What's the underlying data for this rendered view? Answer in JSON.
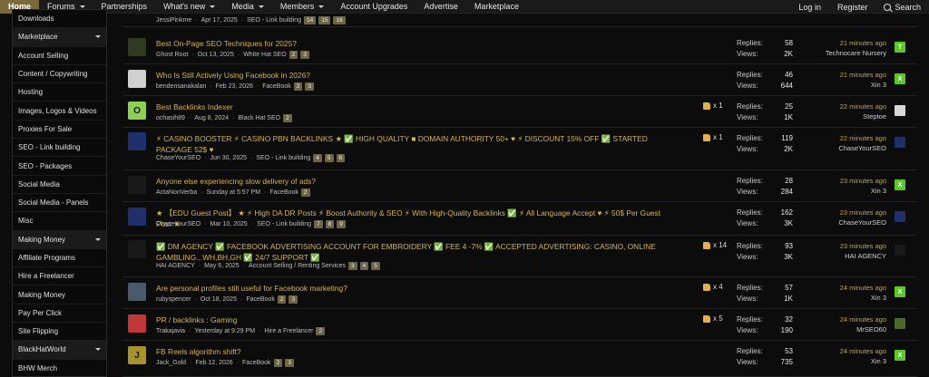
{
  "nav": {
    "items": [
      {
        "label": "Home",
        "caret": false
      },
      {
        "label": "Forums",
        "caret": true
      },
      {
        "label": "Partnerships",
        "caret": false
      },
      {
        "label": "What's new",
        "caret": true
      },
      {
        "label": "Media",
        "caret": true
      },
      {
        "label": "Members",
        "caret": true
      },
      {
        "label": "Account Upgrades",
        "caret": false
      },
      {
        "label": "Advertise",
        "caret": false
      },
      {
        "label": "Marketplace",
        "caret": false
      }
    ],
    "login": "Log in",
    "register": "Register",
    "search": "Search"
  },
  "sidebar": {
    "items": [
      {
        "label": "Downloads",
        "header": false
      },
      {
        "label": "Marketplace",
        "header": true
      },
      {
        "label": "Account Selling",
        "header": false
      },
      {
        "label": "Content / Copywriting",
        "header": false
      },
      {
        "label": "Hosting",
        "header": false
      },
      {
        "label": "Images, Logos & Videos",
        "header": false
      },
      {
        "label": "Proxies For Sale",
        "header": false
      },
      {
        "label": "SEO - Link building",
        "header": false
      },
      {
        "label": "SEO - Packages",
        "header": false
      },
      {
        "label": "Social Media",
        "header": false
      },
      {
        "label": "Social Media - Panels",
        "header": false
      },
      {
        "label": "Misc",
        "header": false
      },
      {
        "label": "Making Money",
        "header": true
      },
      {
        "label": "Affiliate Programs",
        "header": false
      },
      {
        "label": "Hire a Freelancer",
        "header": false
      },
      {
        "label": "Making Money",
        "header": false
      },
      {
        "label": "Pay Per Click",
        "header": false
      },
      {
        "label": "Site Flipping",
        "header": false
      },
      {
        "label": "BlackHatWorld",
        "header": true
      },
      {
        "label": "BHW Merch",
        "header": false
      }
    ]
  },
  "threads": {
    "top_partial": {
      "author": "JessiPinkme",
      "date": "Apr 17, 2025",
      "forum": "SEO - Link building",
      "pages": [
        "14",
        "15",
        "16"
      ]
    },
    "rows": [
      {
        "title": "Best On-Page SEO Techniques for 2025?",
        "author": "Ghost Root",
        "date": "Oct 13, 2025",
        "forum": "White Hat SEO",
        "pages": [
          "2",
          "3"
        ],
        "likes": "",
        "replies": "58",
        "views": "2K",
        "last_time": "21 minutes ago",
        "last_user": "Technocare Nursery",
        "avatar_letter": "",
        "mini_letter": "T"
      },
      {
        "title": "Who Is Still Actively Using Facebook in 2026?",
        "author": "bendensanakalan",
        "date": "Feb 23, 2026",
        "forum": "FaceBook",
        "pages": [
          "2",
          "3"
        ],
        "likes": "",
        "replies": "46",
        "views": "644",
        "last_time": "21 minutes ago",
        "last_user": "Xin 3",
        "avatar_letter": "",
        "mini_letter": "X"
      },
      {
        "title": "Best Backlinks Indexer",
        "author": "ochasih89",
        "date": "Aug 8, 2024",
        "forum": "Black Hat SEO",
        "pages": [
          "2"
        ],
        "likes": "x 1",
        "replies": "25",
        "views": "1K",
        "last_time": "22 minutes ago",
        "last_user": "Steptoe",
        "avatar_letter": "O",
        "mini_letter": ""
      },
      {
        "title": "⚡ CASINO BOOSTER ⚡ CASINO PBN BACKLINKS ★ ✅ HIGH QUALITY ■ DOMAIN AUTHORITY 50+ ♥ ⚡ DISCOUNT 15% OFF ✅ STARTED PACKAGE 52$ ♥",
        "author": "ChaseYourSEO",
        "date": "Jun 30, 2025",
        "forum": "SEO - Link building",
        "pages": [
          "4",
          "5",
          "6"
        ],
        "likes": "x 1",
        "replies": "119",
        "views": "2K",
        "last_time": "22 minutes ago",
        "last_user": "ChaseYourSEO",
        "avatar_letter": "",
        "mini_letter": ""
      },
      {
        "title": "Anyone else experiencing slow delivery of ads?",
        "author": "ActaNonVerba",
        "date": "Sunday at 5:57 PM",
        "forum": "FaceBook",
        "pages": [
          "2"
        ],
        "likes": "",
        "replies": "28",
        "views": "284",
        "last_time": "23 minutes ago",
        "last_user": "Xin 3",
        "avatar_letter": "",
        "mini_letter": "X"
      },
      {
        "title": "★ 【EDU Guest Post】 ★ ⚡ High DA DR Posts ⚡ Boost Authority & SEO ⚡ With High-Quality Backlinks ✅ ⚡ All Language Accept ♥ ⚡ 50$ Per Guest Post ★",
        "author": "ChaseYourSEO",
        "date": "Mar 10, 2025",
        "forum": "SEO - Link building",
        "pages": [
          "7",
          "8",
          "9"
        ],
        "likes": "",
        "replies": "162",
        "views": "3K",
        "last_time": "23 minutes ago",
        "last_user": "ChaseYourSEO",
        "avatar_letter": "",
        "mini_letter": ""
      },
      {
        "title": "✅ DM AGENCY ✅ FACEBOOK ADVERTISING ACCOUNT FOR EMBROIDERY ✅ FEE 4 -7% ✅ ACCEPTED ADVERTISING: CASINO, ONLINE GAMBLING...WH,BH,GH ✅ 24/7 SUPPORT ✅",
        "author": "HAI AGENCY",
        "date": "May 6, 2025",
        "forum": "Account Selling / Renting Services",
        "pages": [
          "3",
          "4",
          "5"
        ],
        "likes": "x 14",
        "replies": "93",
        "views": "3K",
        "last_time": "23 minutes ago",
        "last_user": "HAI AGENCY",
        "avatar_letter": "",
        "mini_letter": ""
      },
      {
        "title": "Are personal profiles still useful for Facebook marketing?",
        "author": "rubyspencer",
        "date": "Oct 18, 2025",
        "forum": "FaceBook",
        "pages": [
          "2",
          "3"
        ],
        "likes": "x 4",
        "replies": "57",
        "views": "1K",
        "last_time": "24 minutes ago",
        "last_user": "Xin 3",
        "avatar_letter": "",
        "mini_letter": "X"
      },
      {
        "title": "PR / backlinks : Gaming",
        "author": "Trakajavia",
        "date": "Yesterday at 9:29 PM",
        "forum": "Hire a Freelancer",
        "pages": [
          "2"
        ],
        "likes": "x 5",
        "replies": "32",
        "views": "190",
        "last_time": "24 minutes ago",
        "last_user": "MrSEO60",
        "avatar_letter": "",
        "mini_letter": ""
      },
      {
        "title": "FB Reels algorithm shift?",
        "author": "Jack_Gold",
        "date": "Feb 12, 2026",
        "forum": "FaceBook",
        "pages": [
          "2",
          "3"
        ],
        "likes": "",
        "replies": "53",
        "views": "735",
        "last_time": "24 minutes ago",
        "last_user": "Xin 3",
        "avatar_letter": "J",
        "mini_letter": "X"
      }
    ],
    "labels": {
      "replies": "Replies:",
      "views": "Views:"
    }
  }
}
